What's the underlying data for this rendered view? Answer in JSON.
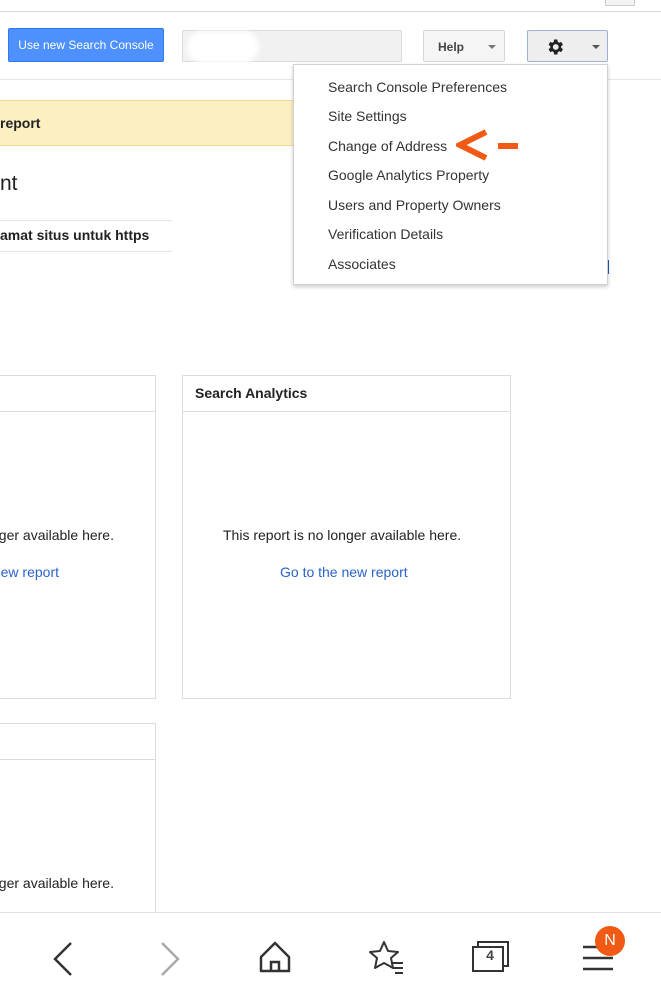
{
  "header": {
    "new_console_button": "Use new Search Console",
    "help_button": "Help",
    "settings_icon": "gear-icon"
  },
  "page": {
    "banner_text": "report",
    "heading_fragment": "nt",
    "row_text": "amat situs untuk https"
  },
  "settings_menu": {
    "items": [
      "Search Console Preferences",
      "Site Settings",
      "Change of Address",
      "Google Analytics Property",
      "Users and Property Owners",
      "Verification Details",
      "Associates"
    ]
  },
  "cards": {
    "left_top": {
      "message": "nger available here.",
      "link": "ew report"
    },
    "search_analytics": {
      "title": "Search Analytics",
      "message": "This report is no longer available here.",
      "link": "Go to the new report"
    },
    "left_bottom": {
      "message": "nger available here."
    }
  },
  "annotation": {
    "color": "#f05a14",
    "icon": "arrow-left-icon"
  },
  "bottom_nav": {
    "back_icon": "chevron-left-icon",
    "forward_icon": "chevron-right-icon",
    "home_icon": "home-icon",
    "bookmarks_icon": "star-list-icon",
    "tabs_icon": "tabs-icon",
    "tabs_count": "4",
    "menu_icon": "hamburger-menu-icon",
    "badge_letter": "N"
  },
  "colors": {
    "primary_button": "#4d90fe",
    "link": "#2a64c9",
    "banner": "#fcefc2",
    "badge": "#f05a14"
  }
}
